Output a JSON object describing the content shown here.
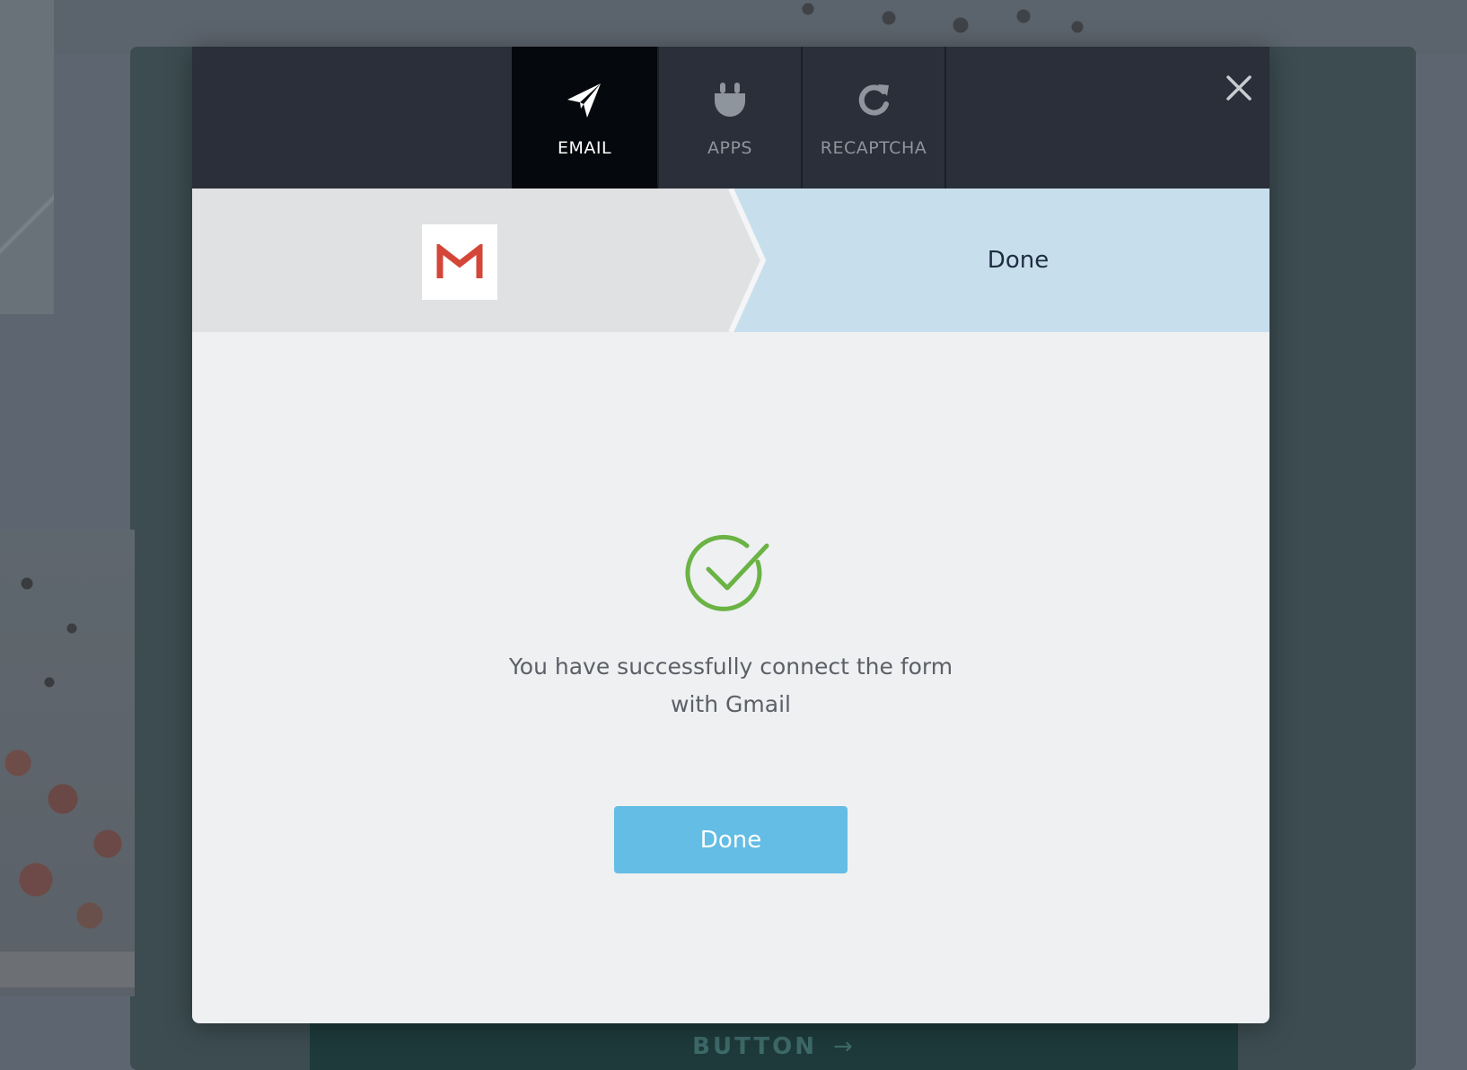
{
  "background": {
    "bottom_button_label": "BUTTON",
    "bottom_button_arrow": "→"
  },
  "modal": {
    "tabs": [
      {
        "label": "EMAIL",
        "icon": "paper-plane-icon",
        "active": true
      },
      {
        "label": "APPS",
        "icon": "plug-icon",
        "active": false
      },
      {
        "label": "RECAPTCHA",
        "icon": "refresh-icon",
        "active": false
      }
    ],
    "close_icon": "close-icon",
    "steps": {
      "current_logo": "gmail-logo",
      "done_label": "Done"
    },
    "success": {
      "icon": "check-circle-icon",
      "message": "You have successfully connect the form with Gmail",
      "button_label": "Done"
    }
  },
  "colors": {
    "tabbar": "#2a2f39",
    "active_tab": "#05080d",
    "step_active": "#c7dfec",
    "step_inactive": "#e0e1e3",
    "success_green": "#6ab344",
    "done_button": "#63bde5",
    "gmail_red": "#d44638"
  }
}
